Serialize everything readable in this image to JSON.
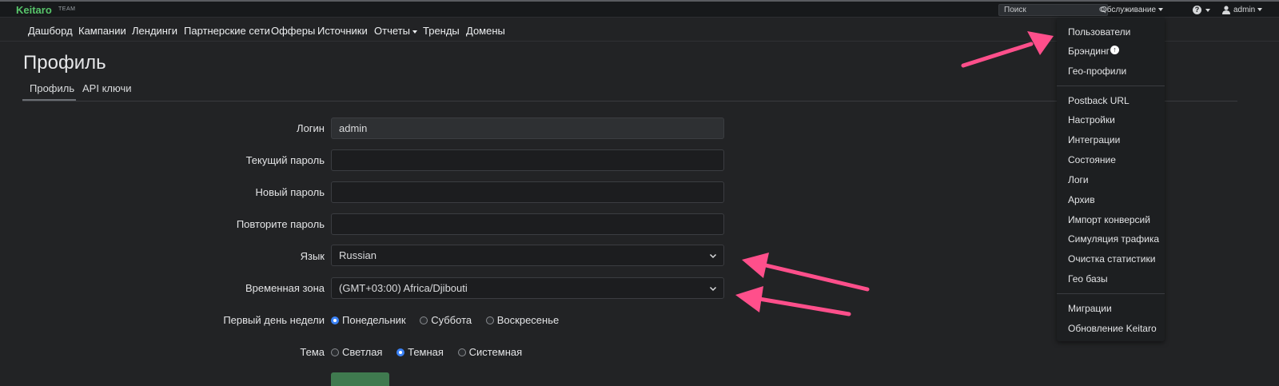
{
  "app": {
    "logo": "Keitaro",
    "logo_sub": "TEAM"
  },
  "topbar": {
    "search_placeholder": "Поиск",
    "service_menu": "Обслуживание",
    "user_menu": "admin"
  },
  "nav": [
    "Дашборд",
    "Кампании",
    "Лендинги",
    "Партнерские сети",
    "Офферы",
    "Источники",
    "Отчеты",
    "Тренды",
    "Домены"
  ],
  "page": {
    "title": "Профиль",
    "tabs": [
      "Профиль",
      "API ключи"
    ]
  },
  "form": {
    "login_label": "Логин",
    "login_value": "admin",
    "current_password_label": "Текущий пароль",
    "new_password_label": "Новый пароль",
    "repeat_password_label": "Повторите пароль",
    "language_label": "Язык",
    "language_value": "Russian",
    "timezone_label": "Временная зона",
    "timezone_value": "(GMT+03:00) Africa/Djibouti",
    "first_day_label": "Первый день недели",
    "first_day_options": [
      "Понедельник",
      "Суббота",
      "Воскресенье"
    ],
    "theme_label": "Тема",
    "theme_options": [
      "Светлая",
      "Темная",
      "Системная"
    ]
  },
  "dropdown": {
    "group1": [
      "Пользователи",
      "Брэндинг",
      "Гео-профили"
    ],
    "group2": [
      "Postback URL",
      "Настройки",
      "Интеграции",
      "Состояние",
      "Логи",
      "Архив",
      "Импорт конверсий",
      "Симуляция трафика",
      "Очистка статистики",
      "Гео базы"
    ],
    "group3": [
      "Миграции",
      "Обновление Keitaro"
    ]
  },
  "colors": {
    "accent_green": "#57c46a",
    "arrow_pink": "#ff4f8b",
    "radio_blue": "#3b82f6"
  }
}
